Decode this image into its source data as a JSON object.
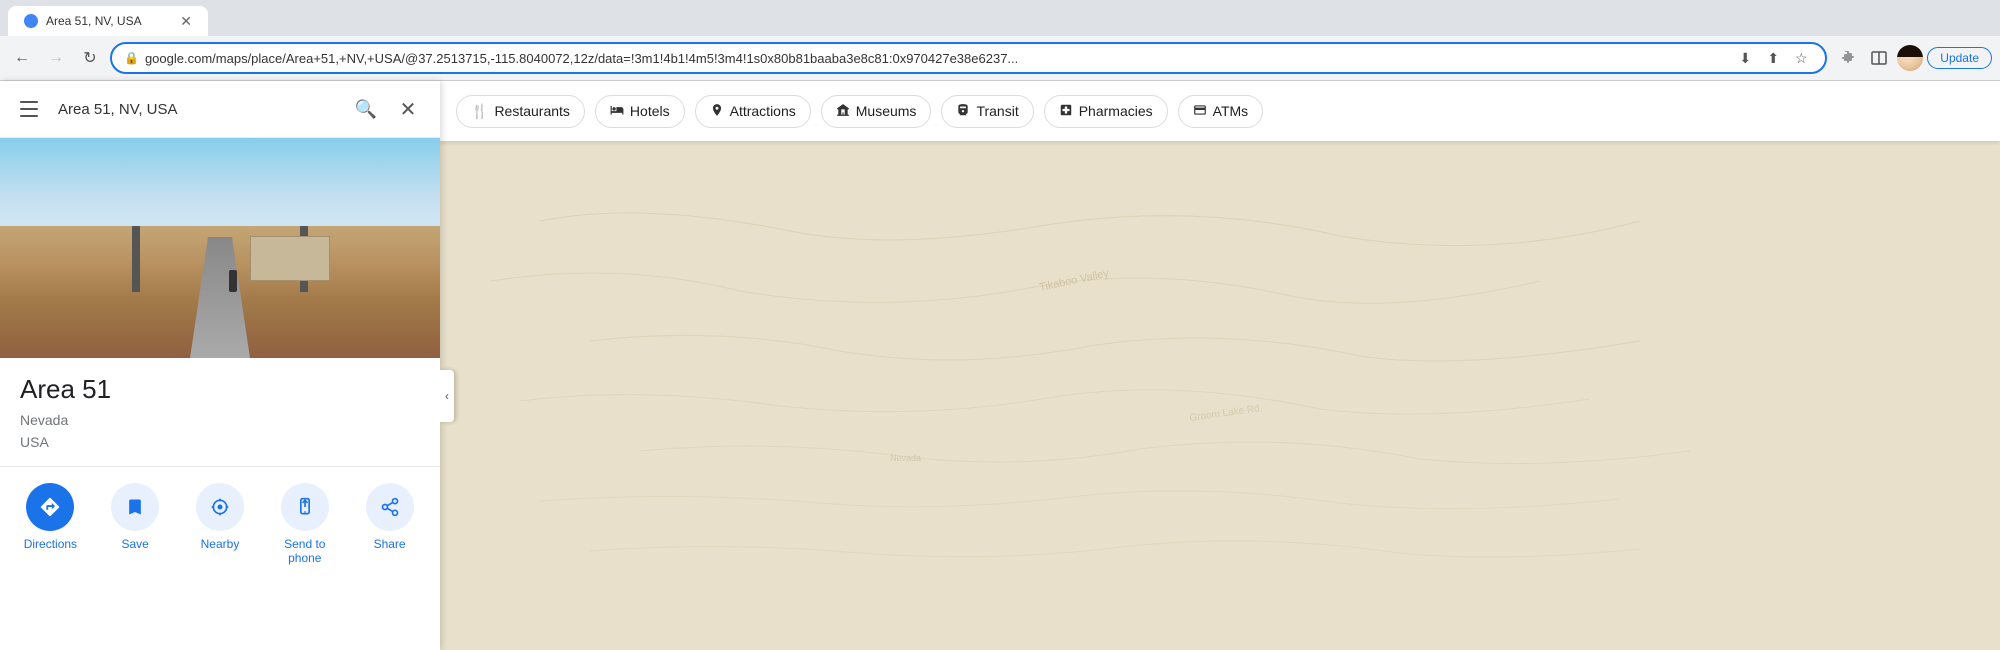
{
  "browser": {
    "tab_title": "Area 51, NV, USA",
    "url": "google.com/maps/place/Area+51,+NV,+USA/@37.2513715,-115.8040072,12z/data=!3m1!4b1!4m5!3m4!1s0x80b81baaba3e8c81:0x970427e38e6237...",
    "back_disabled": false,
    "forward_disabled": false,
    "update_label": "Update"
  },
  "sidebar": {
    "search_text": "Area 51, NV, USA",
    "place": {
      "title": "Area 51",
      "subtitle_line1": "Nevada",
      "subtitle_line2": "USA"
    },
    "actions": [
      {
        "id": "directions",
        "label": "Directions",
        "icon": "◈",
        "filled": true
      },
      {
        "id": "save",
        "label": "Save",
        "icon": "🔖",
        "filled": false
      },
      {
        "id": "nearby",
        "label": "Nearby",
        "icon": "⊕",
        "filled": false
      },
      {
        "id": "send-to-phone",
        "label": "Send to phone",
        "icon": "📱",
        "filled": false
      },
      {
        "id": "share",
        "label": "Share",
        "icon": "↗",
        "filled": false
      }
    ]
  },
  "map": {
    "filter_chips": [
      {
        "id": "restaurants",
        "label": "Restaurants",
        "icon": "🍴"
      },
      {
        "id": "hotels",
        "label": "Hotels",
        "icon": "🛏"
      },
      {
        "id": "attractions",
        "label": "Attractions",
        "icon": "🏛"
      },
      {
        "id": "museums",
        "label": "Museums",
        "icon": "🏛"
      },
      {
        "id": "transit",
        "label": "Transit",
        "icon": "🚌"
      },
      {
        "id": "pharmacies",
        "label": "Pharmacies",
        "icon": "+"
      },
      {
        "id": "atms",
        "label": "ATMs",
        "icon": "💳"
      }
    ]
  }
}
